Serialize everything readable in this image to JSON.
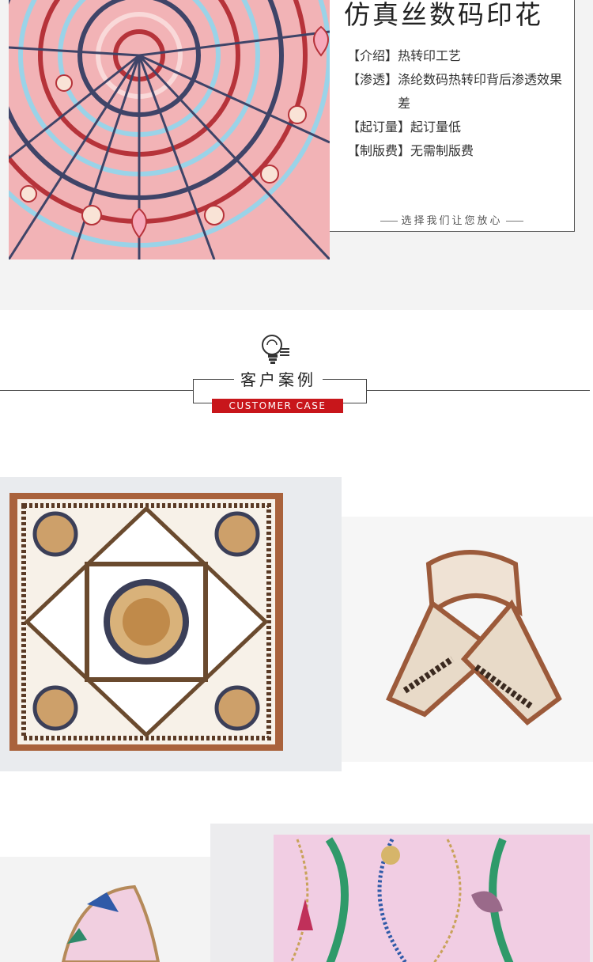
{
  "product": {
    "title": "仿真丝数码印花",
    "rows": [
      {
        "key": "【介绍】",
        "value": "热转印工艺"
      },
      {
        "key": "【渗透】",
        "value": "涤纶数码热转印背后渗透效果差"
      },
      {
        "key": "【起订量】",
        "value": "起订量低"
      },
      {
        "key": "【制版费】",
        "value": "无需制版费"
      }
    ],
    "footer": "选择我们让您放心"
  },
  "section": {
    "title": "客户案例",
    "subtitle": "CUSTOMER CASE",
    "icon": "lightbulb-icon",
    "accent_color": "#c8161b"
  },
  "photos": [
    {
      "name": "case-photo-square-scarf"
    },
    {
      "name": "case-photo-tied-scarf"
    },
    {
      "name": "case-photo-pink-tied-scarf"
    },
    {
      "name": "case-photo-pink-chain-scarf"
    }
  ]
}
